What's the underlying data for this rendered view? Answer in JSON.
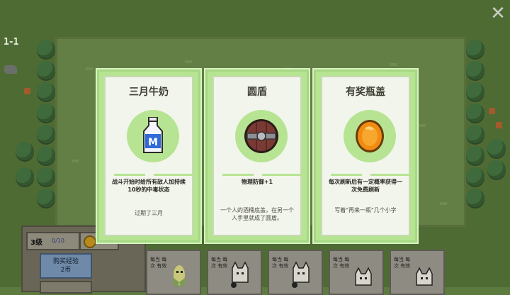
{
  "hud": {
    "wave": "1-1",
    "level": "3级",
    "xp": "0/10",
    "coins": "5",
    "buy_xp_label": "购买经验",
    "buy_xp_cost": "2币"
  },
  "shop_cards": [
    {
      "text": "每当 每次 有效"
    },
    {
      "text": "每当 每次 有效"
    },
    {
      "text": "每当 每次 有效"
    },
    {
      "text": "每当 每次 有效"
    },
    {
      "text": "每当 每次 有效"
    }
  ],
  "choices": [
    {
      "title": "三月牛奶",
      "icon": "milk-bottle-icon",
      "effect": "战斗开始时给所有敌人加持续10秒的中毒状态",
      "desc": "过期了三月"
    },
    {
      "title": "圆盾",
      "icon": "round-shield-icon",
      "effect": "物理防御+1",
      "desc": "一个人的酒桶底盖，在另一个人手里就成了圆盾。"
    },
    {
      "title": "有奖瓶盖",
      "icon": "bottle-cap-icon",
      "effect": "每次刷新后有一定概率获得一次免费刷新",
      "desc": "写着\"再来一瓶\"几个小字"
    }
  ],
  "colors": {
    "card_border": "#b7e493",
    "card_body": "#f2f5ec",
    "background": "#4f6b34"
  }
}
